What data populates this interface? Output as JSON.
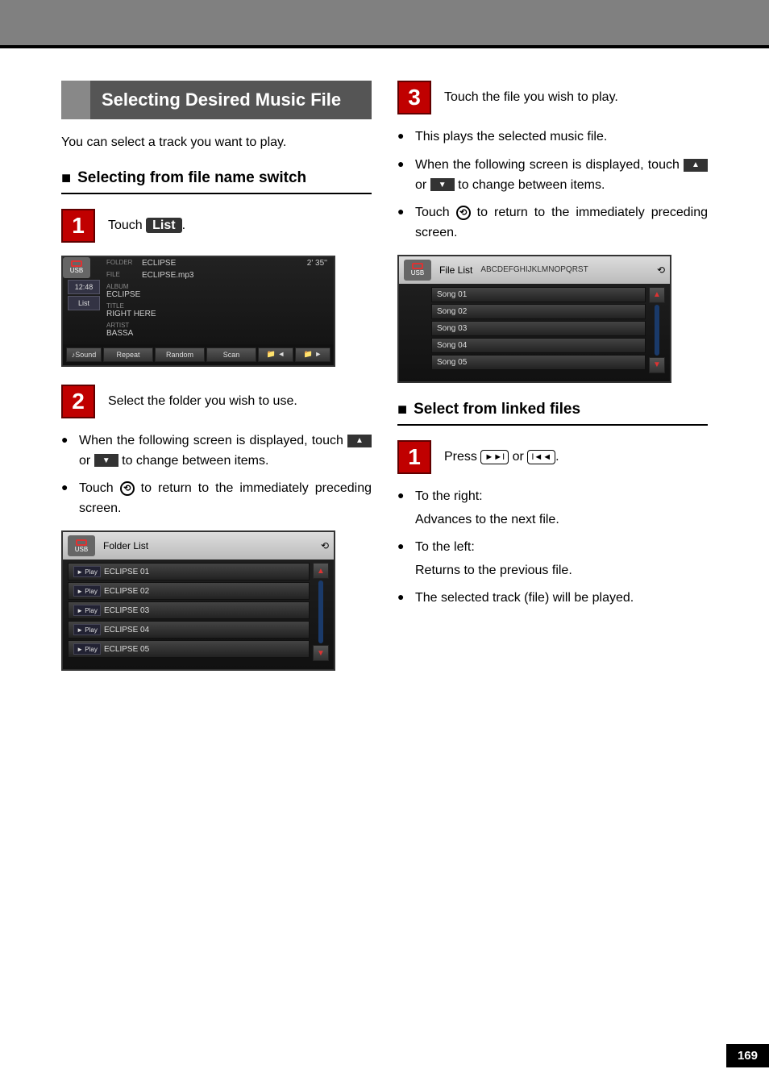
{
  "page_number": "169",
  "section_title": "Selecting Desired Music File",
  "intro": "You can select a track you want to play.",
  "sub1": {
    "heading": "Selecting from file name switch",
    "step1": {
      "num": "1",
      "pre": "Touch ",
      "key": "List",
      "post": "."
    },
    "step2": {
      "num": "2",
      "text": "Select the folder you wish to use."
    },
    "bullets": [
      {
        "pre": "When the following screen is displayed, touch ",
        "mid": " or ",
        "post": " to change between items.",
        "icons": [
          "up",
          "down"
        ]
      },
      {
        "pre": "Touch ",
        "post": " to return to the immediately preceding screen.",
        "icon": "return"
      }
    ]
  },
  "right": {
    "step3": {
      "num": "3",
      "text": "Touch the file you wish to play."
    },
    "bullets": [
      {
        "text": "This plays the selected music file."
      },
      {
        "pre": "When the following screen is displayed, touch ",
        "mid": " or ",
        "post": " to change between items.",
        "icons": [
          "up",
          "down"
        ]
      },
      {
        "pre": "Touch ",
        "post": " to return to the immediately preceding screen.",
        "icon": "return"
      }
    ]
  },
  "sub2": {
    "heading": "Select from linked files",
    "step1": {
      "num": "1",
      "pre": "Press ",
      "mid": " or ",
      "post": "."
    },
    "bullets": [
      {
        "head": "To the right:",
        "body": "Advances to the next file."
      },
      {
        "head": "To the left:",
        "body": "Returns to the previous file."
      },
      {
        "text": "The selected track (file) will be played."
      }
    ]
  },
  "screen_now": {
    "mode": "USB",
    "folder_label": "FOLDER",
    "folder": "ECLIPSE",
    "file_label": "FILE",
    "file": "ECLIPSE.mp3",
    "time": "2' 35''",
    "clock": "12:48",
    "list_btn": "List",
    "album_label": "ALBUM",
    "album": "ECLIPSE",
    "title_label": "TITLE",
    "title": "RIGHT HERE",
    "artist_label": "ARTIST",
    "artist": "BASSA",
    "buttons": [
      "♪Sound",
      "Repeat",
      "Random",
      "Scan",
      "📁 ◄",
      "📁 ►"
    ]
  },
  "screen_folder": {
    "mode": "USB",
    "title": "Folder List",
    "items": [
      "ECLIPSE 01",
      "ECLIPSE 02",
      "ECLIPSE 03",
      "ECLIPSE 04",
      "ECLIPSE 05"
    ],
    "play": "► Play"
  },
  "screen_file": {
    "mode": "USB",
    "title": "File List",
    "sub": "ABCDEFGHIJKLMNOPQRST",
    "items": [
      "Song 01",
      "Song 02",
      "Song 03",
      "Song 04",
      "Song 05"
    ]
  }
}
